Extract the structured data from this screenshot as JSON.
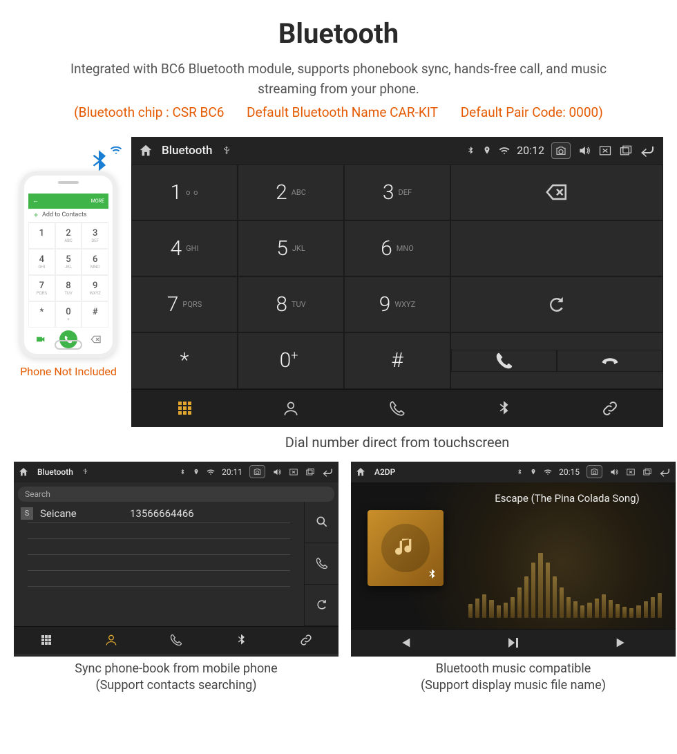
{
  "header": {
    "title": "Bluetooth",
    "subtitle": "Integrated with BC6 Bluetooth module, supports phonebook sync, hands-free call, and music streaming from your phone.",
    "spec_chip": "(Bluetooth chip : CSR BC6",
    "spec_name": "Default Bluetooth Name CAR-KIT",
    "spec_code": "Default Pair Code: 0000)"
  },
  "phone_mock": {
    "topbar_left": "←",
    "topbar_right": "MORE",
    "add_contacts": "Add to Contacts",
    "keys": [
      {
        "n": "1",
        "l": ""
      },
      {
        "n": "2",
        "l": "ABC"
      },
      {
        "n": "3",
        "l": "DEF"
      },
      {
        "n": "4",
        "l": "GHI"
      },
      {
        "n": "5",
        "l": "JKL"
      },
      {
        "n": "6",
        "l": "MNO"
      },
      {
        "n": "7",
        "l": "PQRS"
      },
      {
        "n": "8",
        "l": "TUV"
      },
      {
        "n": "9",
        "l": "WXYZ"
      },
      {
        "n": "*",
        "l": ""
      },
      {
        "n": "0",
        "l": "+"
      },
      {
        "n": "#",
        "l": ""
      }
    ],
    "caption": "Phone Not Included"
  },
  "dialer": {
    "status": {
      "title": "Bluetooth",
      "time": "20:12"
    },
    "keys": [
      {
        "d": "1",
        "l": "∞"
      },
      {
        "d": "2",
        "l": "ABC"
      },
      {
        "d": "3",
        "l": "DEF"
      },
      {
        "d": "4",
        "l": "GHI"
      },
      {
        "d": "5",
        "l": "JKL"
      },
      {
        "d": "6",
        "l": "MNO"
      },
      {
        "d": "7",
        "l": "PQRS"
      },
      {
        "d": "8",
        "l": "TUV"
      },
      {
        "d": "9",
        "l": "WXYZ"
      },
      {
        "d": "*",
        "l": ""
      },
      {
        "d": "0",
        "l": "+"
      },
      {
        "d": "#",
        "l": ""
      }
    ],
    "caption": "Dial number direct from touchscreen"
  },
  "contacts": {
    "status": {
      "title": "Bluetooth",
      "time": "20:11"
    },
    "search_placeholder": "Search",
    "rows": [
      {
        "badge": "S",
        "name": "Seicane",
        "number": "13566664466"
      }
    ],
    "caption_l1": "Sync phone-book from mobile phone",
    "caption_l2": "(Support contacts searching)"
  },
  "music": {
    "status": {
      "title": "A2DP",
      "time": "20:15"
    },
    "song": "Escape (The Pina Colada Song)",
    "eq_heights": [
      20,
      28,
      34,
      26,
      18,
      22,
      30,
      44,
      60,
      80,
      94,
      80,
      60,
      44,
      30,
      24,
      18,
      22,
      28,
      34,
      26,
      20,
      16,
      14,
      18,
      24,
      30,
      36
    ],
    "caption_l1": "Bluetooth music compatible",
    "caption_l2": "(Support display music file name)"
  }
}
